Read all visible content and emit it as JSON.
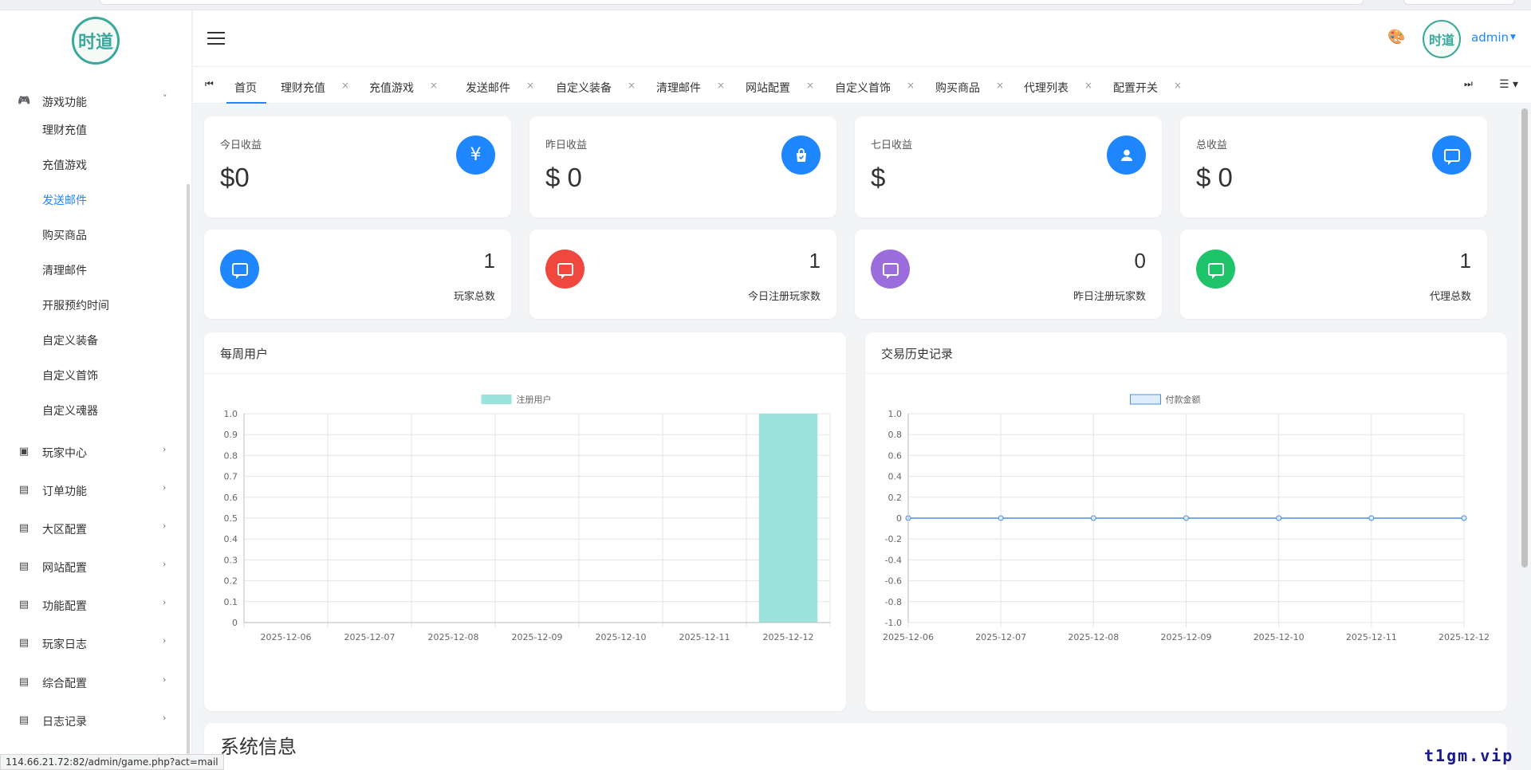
{
  "sidebar": {
    "logo_text": "时道",
    "groups": [
      {
        "label": "游戏功能",
        "icon": "gamepad-icon",
        "expanded": true
      },
      {
        "label": "玩家中心",
        "icon": "user-card-icon"
      },
      {
        "label": "订单功能",
        "icon": "list-card-icon"
      },
      {
        "label": "大区配置",
        "icon": "list-card-icon"
      },
      {
        "label": "网站配置",
        "icon": "list-card-icon"
      },
      {
        "label": "功能配置",
        "icon": "list-card-icon"
      },
      {
        "label": "玩家日志",
        "icon": "list-card-icon"
      },
      {
        "label": "综合配置",
        "icon": "list-card-icon"
      },
      {
        "label": "日志记录",
        "icon": "list-card-icon"
      }
    ],
    "sub_items": [
      "理财充值",
      "充值游戏",
      "发送邮件",
      "购买商品",
      "清理邮件",
      "开服预约时间",
      "自定义装备",
      "自定义首饰",
      "自定义魂器"
    ],
    "active_sub": "发送邮件"
  },
  "header": {
    "user": "admin",
    "avatar_text": "时道"
  },
  "tabs": [
    "首页",
    "理财充值",
    "充值游戏",
    "发送邮件",
    "自定义装备",
    "清理邮件",
    "网站配置",
    "自定义首饰",
    "购买商品",
    "代理列表",
    "配置开关"
  ],
  "active_tab": "首页",
  "revenue_cards": [
    {
      "label": "今日收益",
      "value": "$0",
      "icon": "yen-icon",
      "color": "#1e86ff"
    },
    {
      "label": "昨日收益",
      "value": "$ 0",
      "icon": "shopping-bag-icon",
      "color": "#1e86ff"
    },
    {
      "label": "七日收益",
      "value": "$",
      "icon": "user-icon",
      "color": "#1e86ff"
    },
    {
      "label": "总收益",
      "value": "$ 0",
      "icon": "chat-icon",
      "color": "#1e86ff"
    }
  ],
  "count_cards": [
    {
      "label": "玩家总数",
      "value": "1",
      "icon": "chat-icon",
      "color": "#1e86ff"
    },
    {
      "label": "今日注册玩家数",
      "value": "1",
      "icon": "chat-icon",
      "color": "#f0483e"
    },
    {
      "label": "昨日注册玩家数",
      "value": "0",
      "icon": "chat-icon",
      "color": "#9b6ddc"
    },
    {
      "label": "代理总数",
      "value": "1",
      "icon": "chat-icon",
      "color": "#1fc46a"
    }
  ],
  "panels": {
    "weekly_users": "每周用户",
    "transactions": "交易历史记录",
    "system_info": "系统信息"
  },
  "chart_data": [
    {
      "type": "bar",
      "categories": [
        "2025-12-06",
        "2025-12-07",
        "2025-12-08",
        "2025-12-09",
        "2025-12-10",
        "2025-12-11",
        "2025-12-12"
      ],
      "series": [
        {
          "name": "注册用户",
          "values": [
            0,
            0,
            0,
            0,
            0,
            0,
            1
          ],
          "color": "#9de3dd"
        }
      ],
      "ylim": [
        0,
        1.0
      ],
      "yticks": [
        "1.0",
        "0.9",
        "0.8",
        "0.7",
        "0.6",
        "0.5",
        "0.4",
        "0.3",
        "0.2",
        "0.1",
        "0"
      ],
      "grid": true,
      "legend": "top-center"
    },
    {
      "type": "line",
      "categories": [
        "2025-12-06",
        "2025-12-07",
        "2025-12-08",
        "2025-12-09",
        "2025-12-10",
        "2025-12-11",
        "2025-12-12"
      ],
      "series": [
        {
          "name": "付款金额",
          "values": [
            0,
            0,
            0,
            0,
            0,
            0,
            0
          ],
          "color": "#4a90e2"
        }
      ],
      "ylim": [
        -1.0,
        1.0
      ],
      "yticks": [
        "1.0",
        "0.8",
        "0.6",
        "0.4",
        "0.2",
        "0",
        "-0.2",
        "-0.4",
        "-0.6",
        "-0.8",
        "-1.0"
      ],
      "grid": true,
      "legend": "top-center"
    }
  ],
  "status_url": "114.66.21.72:82/admin/game.php?act=mail",
  "watermark": "t1gm.vip"
}
